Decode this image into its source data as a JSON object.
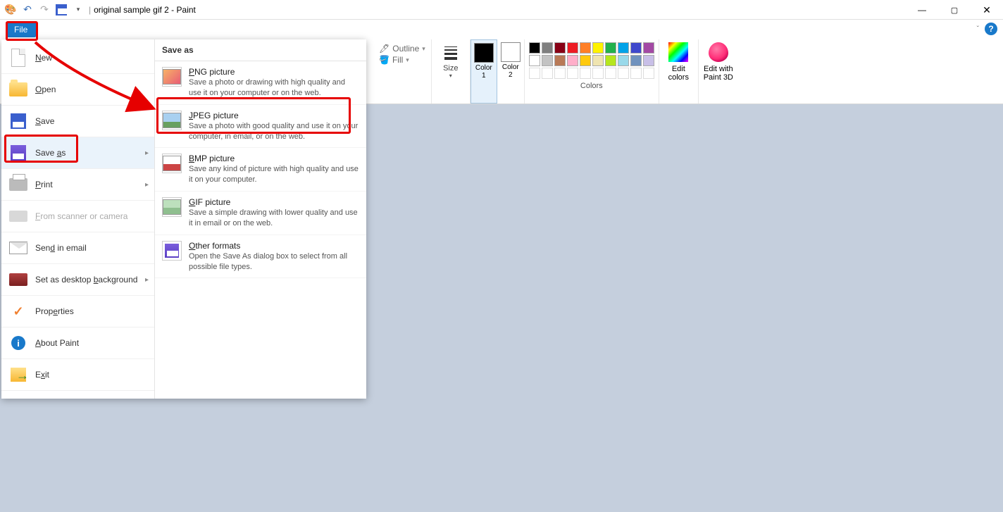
{
  "titlebar": {
    "title": "original sample gif 2 - Paint"
  },
  "tabs": {
    "file": "File"
  },
  "ribbon": {
    "outline": "Outline",
    "fill": "Fill",
    "size": "Size",
    "color1": "Color\n1",
    "color2": "Color\n2",
    "colors_label": "Colors",
    "edit_colors": "Edit\ncolors",
    "paint3d": "Edit with\nPaint 3D",
    "palette_row1": [
      "#000000",
      "#7f7f7f",
      "#880015",
      "#ed1c24",
      "#ff7f27",
      "#fff200",
      "#22b14c",
      "#00a2e8",
      "#3f48cc",
      "#a349a4"
    ],
    "palette_row2": [
      "#ffffff",
      "#c3c3c3",
      "#b97a57",
      "#ffaec9",
      "#ffc90e",
      "#efe4b0",
      "#b5e61d",
      "#99d9ea",
      "#7092be",
      "#c8bfe7"
    ]
  },
  "file_menu": {
    "items": [
      {
        "label": "New"
      },
      {
        "label": "Open"
      },
      {
        "label": "Save"
      },
      {
        "label": "Save as",
        "submenu": true
      },
      {
        "label": "Print",
        "submenu": true
      },
      {
        "label": "From scanner or camera"
      },
      {
        "label": "Send in email"
      },
      {
        "label": "Set as desktop background",
        "submenu": true
      },
      {
        "label": "Properties"
      },
      {
        "label": "About Paint"
      },
      {
        "label": "Exit"
      }
    ],
    "saveas_header": "Save as",
    "saveas": [
      {
        "title": "PNG picture",
        "desc": "Save a photo or drawing with high quality and use it on your computer or on the web."
      },
      {
        "title": "JPEG picture",
        "desc": "Save a photo with good quality and use it on your computer, in email, or on the web."
      },
      {
        "title": "BMP picture",
        "desc": "Save any kind of picture with high quality and use it on your computer."
      },
      {
        "title": "GIF picture",
        "desc": "Save a simple drawing with lower quality and use it in email or on the web."
      },
      {
        "title": "Other formats",
        "desc": "Open the Save As dialog box to select from all possible file types."
      }
    ]
  }
}
